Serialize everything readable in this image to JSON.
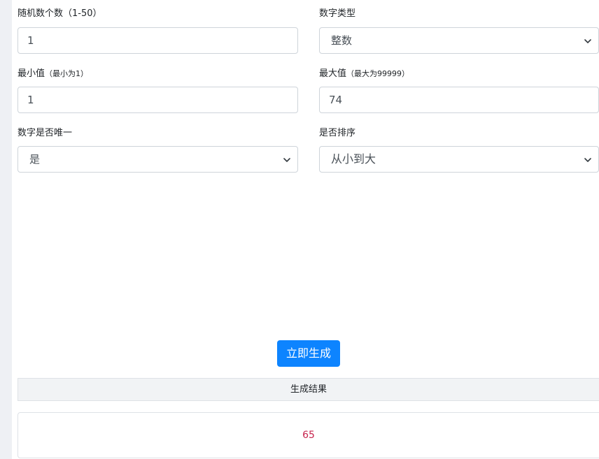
{
  "form": {
    "count": {
      "label": "随机数个数（1-50）",
      "value": "1"
    },
    "type": {
      "label": "数字类型",
      "selected": "整数"
    },
    "min": {
      "label": "最小值",
      "hint": "（最小为1）",
      "value": "1"
    },
    "max": {
      "label": "最大值",
      "hint": "（最大为99999）",
      "value": "74"
    },
    "unique": {
      "label": "数字是否唯一",
      "selected": "是"
    },
    "sort": {
      "label": "是否排序",
      "selected": "从小到大"
    }
  },
  "actions": {
    "generate_label": "立即生成"
  },
  "result": {
    "header": "生成结果",
    "value": "65"
  },
  "colors": {
    "primary": "#0d84ff",
    "result_text": "#c7254e",
    "border": "#ced4da"
  }
}
